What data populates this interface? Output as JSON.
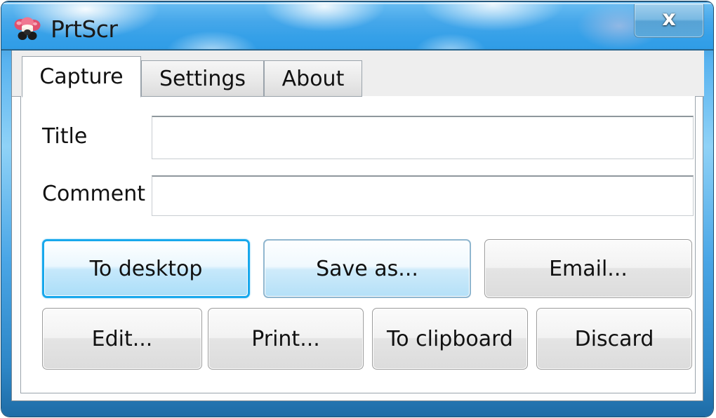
{
  "window": {
    "title": "PrtScr",
    "icon": "mushroom-icon",
    "accent_blue": "#35a0e8",
    "focus_blue": "#18a8ec",
    "close_label": "x"
  },
  "tabs": [
    {
      "label": "Capture",
      "active": true
    },
    {
      "label": "Settings",
      "active": false
    },
    {
      "label": "About",
      "active": false
    }
  ],
  "form": {
    "fields": [
      {
        "label": "Title",
        "value": "",
        "placeholder": ""
      },
      {
        "label": "Comment",
        "value": "",
        "placeholder": ""
      }
    ]
  },
  "actions": {
    "primary_row": [
      {
        "label": "To desktop",
        "style": "focus"
      },
      {
        "label": "Save as...",
        "style": "blue"
      },
      {
        "label": "Email...",
        "style": "gray"
      }
    ],
    "secondary_row": [
      {
        "label": "Edit...",
        "style": "gray"
      },
      {
        "label": "Print...",
        "style": "gray"
      },
      {
        "label": "To clipboard",
        "style": "gray"
      },
      {
        "label": "Discard",
        "style": "gray"
      }
    ]
  }
}
